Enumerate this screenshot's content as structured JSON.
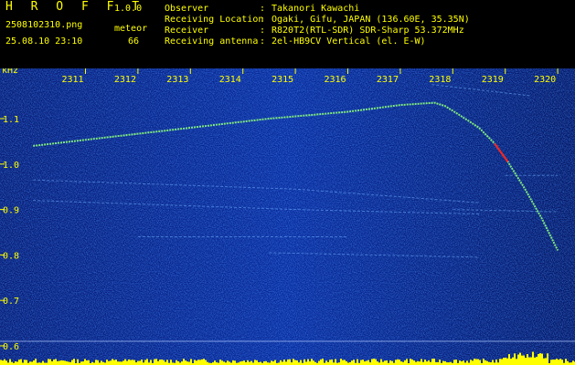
{
  "app": {
    "title": "H R O F F T",
    "version": "1.0.0"
  },
  "image": {
    "filename": "2508102310.png",
    "datetime": "25.08.10 23:10"
  },
  "meteor": {
    "label": "meteor",
    "count": "66"
  },
  "info": [
    {
      "label": "Observer",
      "sep": ":",
      "value": "Takanori Kawachi"
    },
    {
      "label": "Receiving Location",
      "sep": ":",
      "value": "Ogaki, Gifu, JAPAN (136.60E, 35.35N)"
    },
    {
      "label": "Receiver",
      "sep": ":",
      "value": "R820T2(RTL-SDR) SDR-Sharp 53.372MHz"
    },
    {
      "label": "Receiving antenna",
      "sep": ":",
      "value": "2el-HB9CV Vertical (el. E-W)"
    }
  ],
  "colors": {
    "text": "#ffff00",
    "background_noise": "#1a2f9c",
    "meteor_trace": "#7fe87f",
    "strong_trace": "#ff2020",
    "activity_bar": "#ffff00"
  },
  "chart_data": {
    "type": "heatmap",
    "ylabel": "kHz",
    "x_ticks": [
      "2311",
      "2312",
      "2313",
      "2314",
      "2315",
      "2316",
      "2317",
      "2318",
      "2319",
      "2320"
    ],
    "y_ticks": [
      "1.1",
      "1.0",
      "0.9",
      "0.8",
      "0.7",
      "0.6"
    ],
    "ylim": [
      0.58,
      1.17
    ],
    "xlim": [
      23.1,
      23.2
    ],
    "grid": false,
    "traces": [
      {
        "kind": "meteor-head",
        "points": [
          [
            23.1,
            1.04
          ],
          [
            23.115,
            1.06
          ],
          [
            23.13,
            1.08
          ],
          [
            23.145,
            1.1
          ],
          [
            23.16,
            1.115
          ],
          [
            23.17,
            1.13
          ],
          [
            23.1765,
            1.135
          ],
          [
            23.1785,
            1.128
          ],
          [
            23.181,
            1.11
          ],
          [
            23.185,
            1.08
          ],
          [
            23.188,
            1.045
          ],
          [
            23.1905,
            1.005
          ],
          [
            23.1935,
            0.95
          ],
          [
            23.197,
            0.88
          ],
          [
            23.2,
            0.81
          ]
        ]
      },
      {
        "kind": "faint-line",
        "points": [
          [
            23.1,
            0.965
          ],
          [
            23.15,
            0.945
          ],
          [
            23.185,
            0.915
          ]
        ]
      },
      {
        "kind": "faint-line",
        "points": [
          [
            23.1,
            0.92
          ],
          [
            23.15,
            0.9
          ],
          [
            23.185,
            0.89
          ]
        ]
      },
      {
        "kind": "faint-line",
        "points": [
          [
            23.12,
            0.84
          ],
          [
            23.16,
            0.84
          ]
        ]
      },
      {
        "kind": "faint-line",
        "points": [
          [
            23.145,
            0.805
          ],
          [
            23.185,
            0.795
          ]
        ]
      },
      {
        "kind": "faint-line",
        "points": [
          [
            23.176,
            1.175
          ],
          [
            23.195,
            1.15
          ]
        ]
      },
      {
        "kind": "faint-line",
        "points": [
          [
            23.19,
            0.975
          ],
          [
            23.2,
            0.975
          ]
        ]
      },
      {
        "kind": "faint-line",
        "points": [
          [
            23.18,
            0.9
          ],
          [
            23.2,
            0.895
          ]
        ]
      }
    ],
    "baseline_y": 0.61
  }
}
